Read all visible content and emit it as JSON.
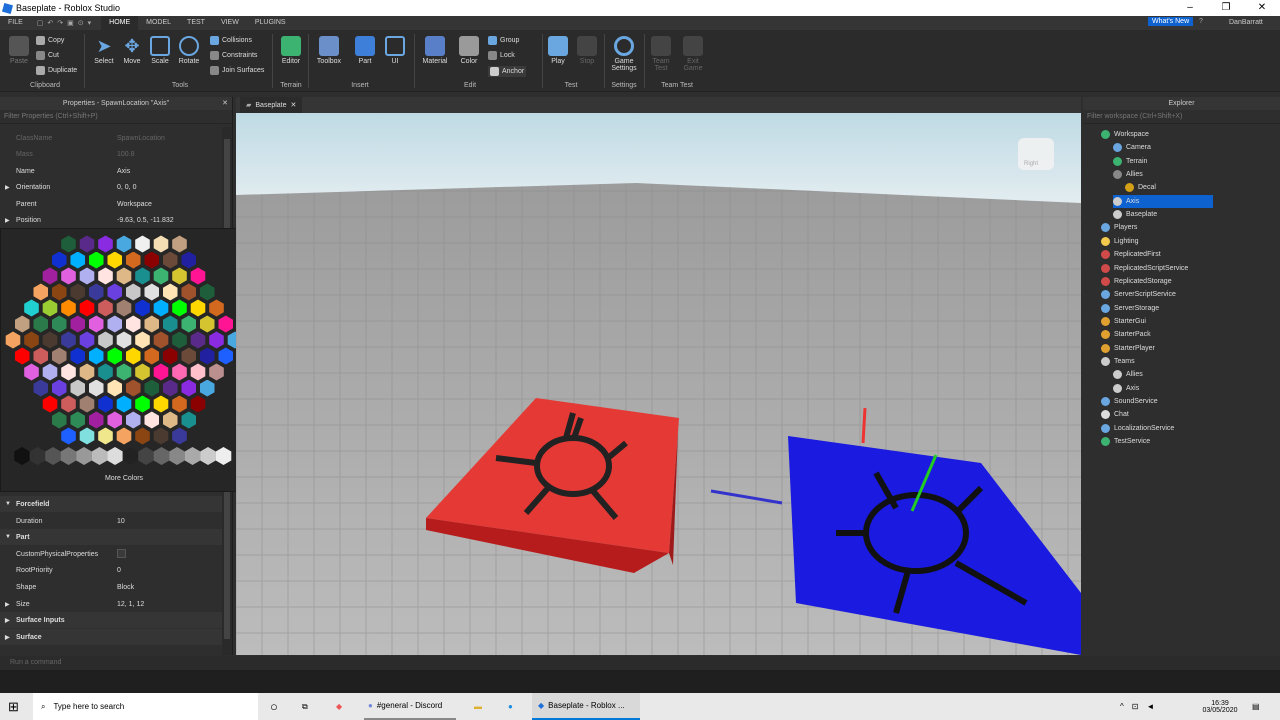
{
  "window": {
    "title": "Baseplate - Roblox Studio"
  },
  "menu": {
    "items": [
      "FILE",
      "HOME",
      "MODEL",
      "TEST",
      "VIEW",
      "PLUGINS"
    ],
    "whats_new": "What's New",
    "user": "DanBarratt"
  },
  "ribbon": {
    "clipboard": {
      "paste": "Paste",
      "copy": "Copy",
      "cut": "Cut",
      "duplicate": "Duplicate",
      "group": "Clipboard"
    },
    "tools": {
      "select": "Select",
      "move": "Move",
      "scale": "Scale",
      "rotate": "Rotate",
      "collisions": "Collisions",
      "constraints": "Constraints",
      "join": "Join Surfaces",
      "group": "Tools"
    },
    "terrain": {
      "editor": "Editor",
      "group": "Terrain"
    },
    "insert": {
      "toolbox": "Toolbox",
      "part": "Part",
      "ui": "UI",
      "group": "Insert"
    },
    "edit": {
      "material": "Material",
      "color": "Color",
      "group_btn": "Group",
      "lock": "Lock",
      "anchor": "Anchor",
      "group": "Edit"
    },
    "test": {
      "play": "Play",
      "stop": "Stop",
      "group": "Test"
    },
    "settings": {
      "game": "Game Settings",
      "group": "Settings"
    },
    "team_test": {
      "team": "Team Test",
      "exit": "Exit Game",
      "group": "Team Test"
    }
  },
  "properties": {
    "header": "Properties - SpawnLocation \"Axis\"",
    "filter": "Filter Properties (Ctrl+Shift+P)",
    "rows": [
      {
        "k": "ClassName",
        "v": "SpawnLocation"
      },
      {
        "k": "Mass",
        "v": "100.8"
      },
      {
        "k": "Name",
        "v": "Axis"
      },
      {
        "k": "Orientation",
        "v": "0, 0, 0"
      },
      {
        "k": "Parent",
        "v": "Workspace"
      },
      {
        "k": "Position",
        "v": "-9.63, 0.5, -11.832"
      }
    ],
    "lower": [
      {
        "k": "Forcefield",
        "v": ""
      },
      {
        "k": "Duration",
        "v": "10"
      },
      {
        "k": "Part",
        "v": ""
      },
      {
        "k": "CustomPhysicalProperties",
        "v": ""
      },
      {
        "k": "RootPriority",
        "v": "0"
      },
      {
        "k": "Shape",
        "v": "Block"
      },
      {
        "k": "Size",
        "v": "12, 1, 12"
      },
      {
        "k": "Surface Inputs",
        "v": ""
      },
      {
        "k": "Surface",
        "v": ""
      }
    ],
    "more_colors": "More Colors"
  },
  "viewport": {
    "tab": "Baseplate",
    "cube_label": "Right"
  },
  "explorer": {
    "header": "Explorer",
    "filter": "Filter workspace (Ctrl+Shift+X)",
    "items": [
      {
        "label": "Workspace",
        "color": "#3cb371"
      },
      {
        "label": "Camera",
        "color": "#6aa6e0"
      },
      {
        "label": "Terrain",
        "color": "#3cb371"
      },
      {
        "label": "Allies",
        "color": "#888888"
      },
      {
        "label": "Decal",
        "color": "#d4a017"
      },
      {
        "label": "Axis",
        "color": "#cccccc"
      },
      {
        "label": "Baseplate",
        "color": "#cccccc"
      },
      {
        "label": "Players",
        "color": "#6aa6e0"
      },
      {
        "label": "Lighting",
        "color": "#f2c94c"
      },
      {
        "label": "ReplicatedFirst",
        "color": "#d04a4a"
      },
      {
        "label": "ReplicatedScriptService",
        "color": "#d04a4a"
      },
      {
        "label": "ReplicatedStorage",
        "color": "#d04a4a"
      },
      {
        "label": "ServerScriptService",
        "color": "#6aa6e0"
      },
      {
        "label": "ServerStorage",
        "color": "#6aa6e0"
      },
      {
        "label": "StarterGui",
        "color": "#e0a030"
      },
      {
        "label": "StarterPack",
        "color": "#e0a030"
      },
      {
        "label": "StarterPlayer",
        "color": "#e0a030"
      },
      {
        "label": "Teams",
        "color": "#cccccc"
      },
      {
        "label": "Allies",
        "color": "#cccccc"
      },
      {
        "label": "Axis",
        "color": "#cccccc"
      },
      {
        "label": "SoundService",
        "color": "#6aa6e0"
      },
      {
        "label": "Chat",
        "color": "#dddddd"
      },
      {
        "label": "LocalizationService",
        "color": "#6aa6e0"
      },
      {
        "label": "TestService",
        "color": "#3cb371"
      }
    ]
  },
  "command_bar": {
    "placeholder": "Run a command"
  },
  "taskbar": {
    "search": "Type here to search",
    "apps": [
      "#general - Discord",
      "Baseplate - Roblox ..."
    ],
    "time": "16:39",
    "date": "03/05/2020"
  },
  "colors": {
    "accent": "#0078d7",
    "selection": "#0e62d0",
    "red_spawn": "#e53935",
    "blue_spawn": "#1a1ae0"
  }
}
